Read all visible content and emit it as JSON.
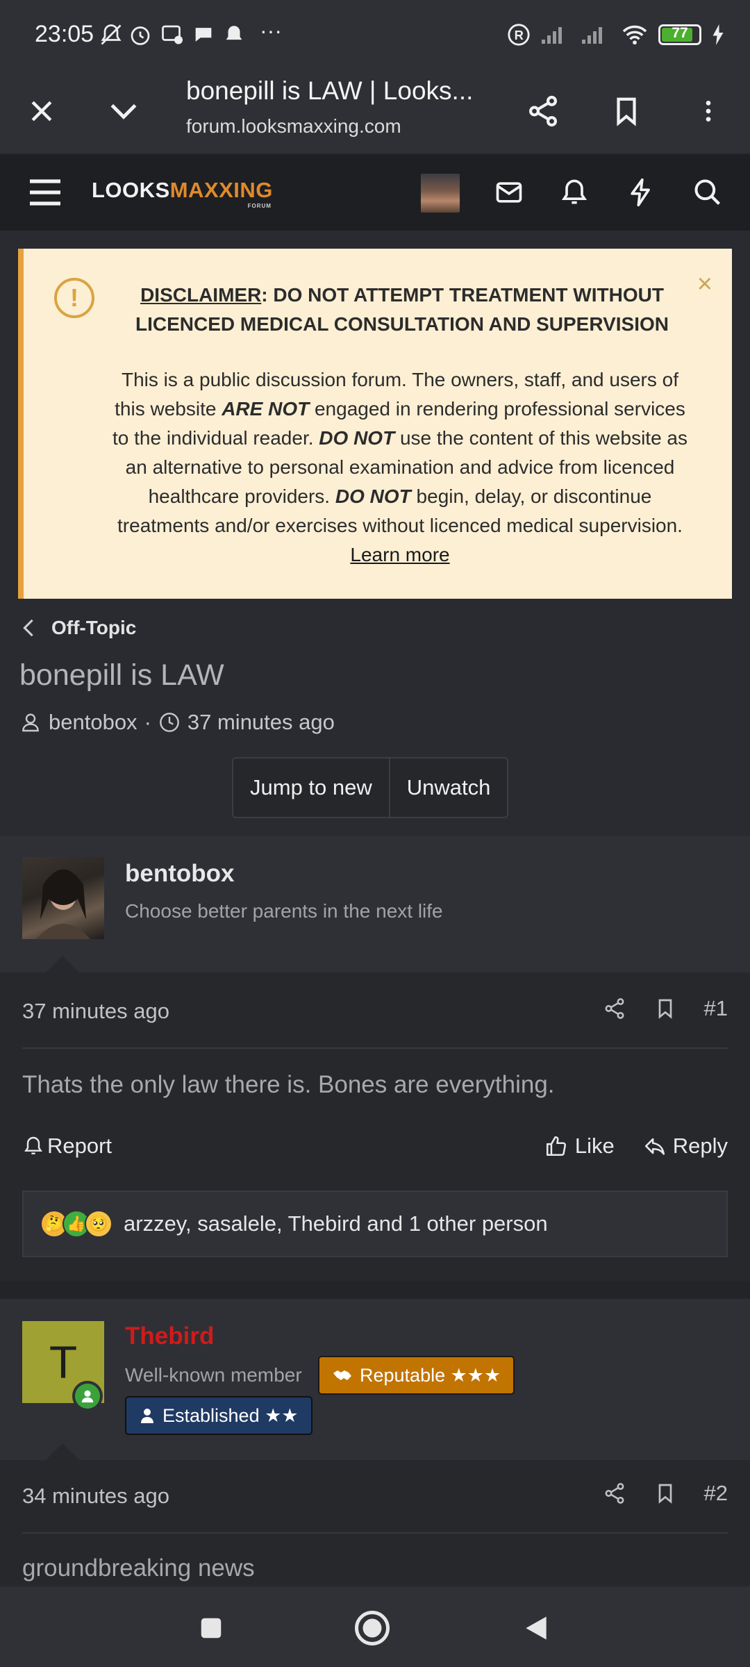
{
  "status_bar": {
    "time": "23:05",
    "battery": "77",
    "icons": [
      "mute-icon",
      "alarm-icon",
      "facebook-icon",
      "chat-icon",
      "bell-icon",
      "more-icon",
      "registered-icon",
      "signal-icon",
      "wifi-icon",
      "battery-icon",
      "charging-icon"
    ]
  },
  "browser": {
    "title": "bonepill is LAW | Looks...",
    "url": "forum.looksmaxxing.com"
  },
  "site": {
    "logo_white": "LOOKS",
    "logo_orange": "MAXXING",
    "logo_sub": "FORUM"
  },
  "disclaimer": {
    "heading_label": "DISCLAIMER",
    "heading_text": ": DO NOT ATTEMPT TREATMENT WITHOUT LICENCED MEDICAL CONSULTATION AND SUPERVISION",
    "body_1": "This is a public discussion forum. The owners, staff, and users of this website ",
    "em_1": "ARE NOT",
    "body_2": " engaged in rendering professional services to the individual reader. ",
    "em_2": "DO NOT",
    "body_3": " use the content of this website as an alternative to personal examination and advice from licenced healthcare providers. ",
    "em_3": "DO NOT",
    "body_4": " begin, delay, or discontinue treatments and/or exercises without licenced medical supervision. ",
    "learn_more": "Learn more",
    "close": "×"
  },
  "thread": {
    "breadcrumb": "Off-Topic",
    "title": "bonepill is LAW",
    "author": "bentobox",
    "separator": "·",
    "age": "37 minutes ago",
    "jump_label": "Jump to new",
    "unwatch_label": "Unwatch"
  },
  "posts": [
    {
      "username": "bentobox",
      "user_title": "Choose better parents in the next life",
      "date": "37 minutes ago",
      "number": "#1",
      "text": "Thats the only law there is. Bones are everything.",
      "report": "Report",
      "like": "Like",
      "reply": "Reply",
      "reactions": "arzzey, sasalele, Thebird and 1 other person"
    },
    {
      "username": "Thebird",
      "avatar_letter": "T",
      "user_title": "Well-known member",
      "badge_reputable": "Reputable ★★★",
      "badge_established": "Established ★★",
      "date": "34 minutes ago",
      "number": "#2",
      "text": "groundbreaking news"
    }
  ],
  "colors": {
    "accent_orange": "#e08a2c",
    "disclaimer_bg": "#fcefd4",
    "username_red": "#d21a1a",
    "badge_reputable": "#c27400",
    "badge_established": "#1f3a63"
  }
}
